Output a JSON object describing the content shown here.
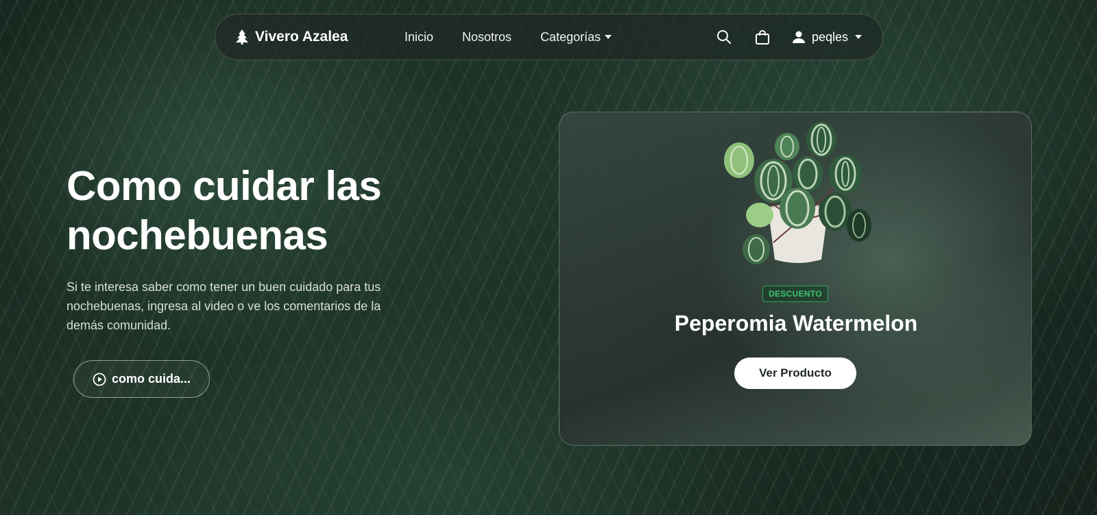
{
  "navbar": {
    "brand": "Vivero Azalea",
    "brand_icon": "tree-icon",
    "links": [
      {
        "label": "Inicio"
      },
      {
        "label": "Nosotros"
      },
      {
        "label": "Categorías"
      }
    ],
    "icons": [
      "search-icon",
      "shopping-bag-icon",
      "user-icon"
    ],
    "user": "peqles"
  },
  "hero": {
    "title": "Como cuidar las nochebuenas",
    "description": "Si te interesa saber como tener un buen cuidado para tus nochebuenas, ingresa al video o ve los comentarios de la demás comunidad.",
    "video_button": "como cuida...",
    "video_icon": "play-circle-icon"
  },
  "product_card": {
    "badge": "DESCUENTO",
    "name": "Peperomia Watermelon",
    "button": "Ver Producto",
    "image": "potted-plant-image"
  },
  "colors": {
    "badge_green": "#3ec46d",
    "button_bg": "#ffffff"
  }
}
